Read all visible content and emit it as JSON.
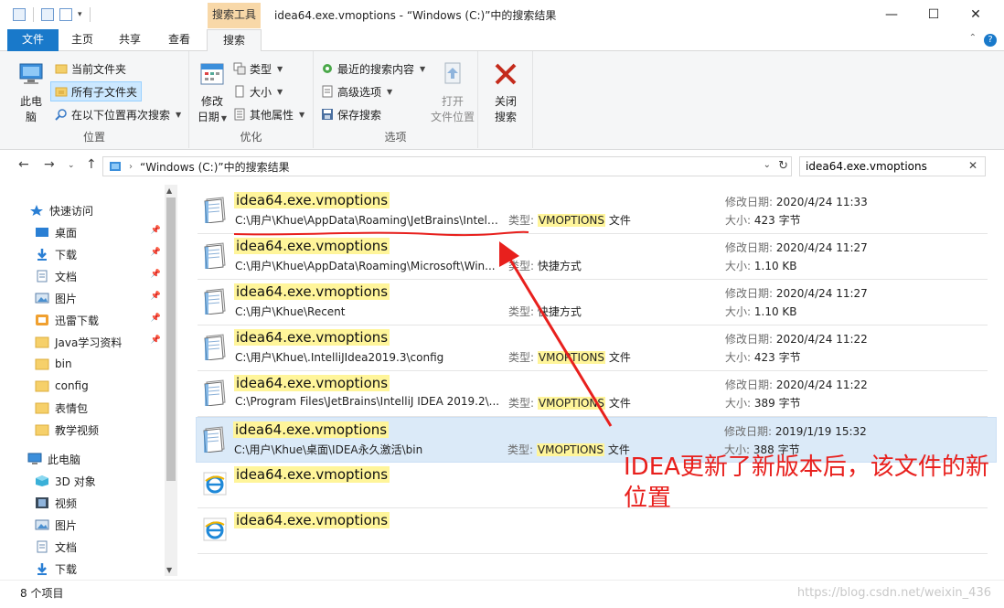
{
  "window": {
    "title": "idea64.exe.vmoptions - “Windows (C:)”中的搜索结果",
    "context_tab": "搜索工具",
    "minimize_icon": "minimize-icon",
    "maximize_icon": "maximize-icon",
    "close_icon": "close-icon"
  },
  "tabs": {
    "file": "文件",
    "home": "主页",
    "share": "共享",
    "view": "查看",
    "search": "搜索",
    "help": "?"
  },
  "ribbon": {
    "location": {
      "label": "位置",
      "this_pc": [
        "此电",
        "脑"
      ],
      "current_folder": "当前文件夹",
      "all_subfolders": "所有子文件夹",
      "search_again": "在以下位置再次搜索"
    },
    "refine": {
      "label": "优化",
      "date_modified": [
        "修改",
        "日期"
      ],
      "type": "类型",
      "size": "大小",
      "other_props": "其他属性"
    },
    "options": {
      "label": "选项",
      "recent_searches": "最近的搜索内容",
      "advanced": "高级选项",
      "save_search": "保存搜索",
      "open_location": [
        "打开",
        "文件位置"
      ],
      "close_search": [
        "关闭",
        "搜索"
      ]
    }
  },
  "address": {
    "path": "“Windows (C:)”中的搜索结果",
    "search_value": "idea64.exe.vmoptions"
  },
  "nav": {
    "items": [
      {
        "label": "快速访问",
        "icon": "star-icon",
        "pinned": false
      },
      {
        "label": "桌面",
        "icon": "desktop-icon",
        "pinned": true
      },
      {
        "label": "下载",
        "icon": "download-icon",
        "pinned": true
      },
      {
        "label": "文档",
        "icon": "document-icon",
        "pinned": true
      },
      {
        "label": "图片",
        "icon": "pictures-icon",
        "pinned": true
      },
      {
        "label": "迅雷下载",
        "icon": "thunder-icon",
        "pinned": true
      },
      {
        "label": "Java学习资料",
        "icon": "folder-icon",
        "pinned": true
      },
      {
        "label": "bin",
        "icon": "folder-icon",
        "pinned": false
      },
      {
        "label": "config",
        "icon": "folder-icon",
        "pinned": false
      },
      {
        "label": "表情包",
        "icon": "folder-icon",
        "pinned": false
      },
      {
        "label": "教学视频",
        "icon": "folder-icon",
        "pinned": false
      },
      {
        "label": "此电脑",
        "icon": "computer-icon",
        "pinned": false
      },
      {
        "label": "3D 对象",
        "icon": "3d-objects-icon",
        "pinned": false
      },
      {
        "label": "视频",
        "icon": "video-icon",
        "pinned": false
      },
      {
        "label": "图片",
        "icon": "pictures-icon",
        "pinned": false
      },
      {
        "label": "文档",
        "icon": "document-icon",
        "pinned": false
      },
      {
        "label": "下载",
        "icon": "download-icon",
        "pinned": false
      }
    ]
  },
  "results": {
    "type_label": "类型:",
    "date_label": "修改日期:",
    "size_label": "大小:",
    "rows": [
      {
        "name": "idea64.exe.vmoptions",
        "path": "C:\\用户\\Khue\\AppData\\Roaming\\JetBrains\\Intell...",
        "type_hl": "VMOPTIONS",
        "type_rest": " 文件",
        "date": "2020/4/24 11:33",
        "size": "423 字节",
        "icon": "text-file-icon"
      },
      {
        "name": "idea64.exe.vmoptions",
        "path": "C:\\用户\\Khue\\AppData\\Roaming\\Microsoft\\Win...",
        "type_hl": "",
        "type_rest": "快捷方式",
        "date": "2020/4/24 11:27",
        "size": "1.10 KB",
        "icon": "text-file-icon"
      },
      {
        "name": "idea64.exe.vmoptions",
        "path": "C:\\用户\\Khue\\Recent",
        "type_hl": "",
        "type_rest": "快捷方式",
        "date": "2020/4/24 11:27",
        "size": "1.10 KB",
        "icon": "text-file-icon"
      },
      {
        "name": "idea64.exe.vmoptions",
        "path": "C:\\用户\\Khue\\.IntelliJIdea2019.3\\config",
        "type_hl": "VMOPTIONS",
        "type_rest": " 文件",
        "date": "2020/4/24 11:22",
        "size": "423 字节",
        "icon": "text-file-icon"
      },
      {
        "name": "idea64.exe.vmoptions",
        "path": "C:\\Program Files\\JetBrains\\IntelliJ IDEA 2019.2\\...",
        "type_hl": "VMOPTIONS",
        "type_rest": " 文件",
        "date": "2020/4/24 11:22",
        "size": "389 字节",
        "icon": "text-file-icon"
      },
      {
        "name": "idea64.exe.vmoptions",
        "path": "C:\\用户\\Khue\\桌面\\IDEA永久激活\\bin",
        "type_hl": "VMOPTIONS",
        "type_rest": " 文件",
        "date": "2019/1/19 15:32",
        "size": "388 字节",
        "icon": "text-file-icon"
      },
      {
        "name": "idea64.exe.vmoptions",
        "path": "",
        "type_hl": "",
        "type_rest": "",
        "date": "",
        "size": "",
        "icon": "ie-icon"
      },
      {
        "name": "idea64.exe.vmoptions",
        "path": "",
        "type_hl": "",
        "type_rest": "",
        "date": "",
        "size": "",
        "icon": "ie-icon"
      }
    ]
  },
  "status": {
    "count": "8 个项目",
    "watermark": "https://blog.csdn.net/weixin_436"
  },
  "annotation": {
    "text": "IDEA更新了新版本后，该文件的新位置",
    "color": "#e8201d"
  },
  "colors": {
    "accent": "#1979ca",
    "highlight": "#fff59a",
    "context_tab": "#f8d8a8",
    "selected_row": "#dbeaf8"
  }
}
